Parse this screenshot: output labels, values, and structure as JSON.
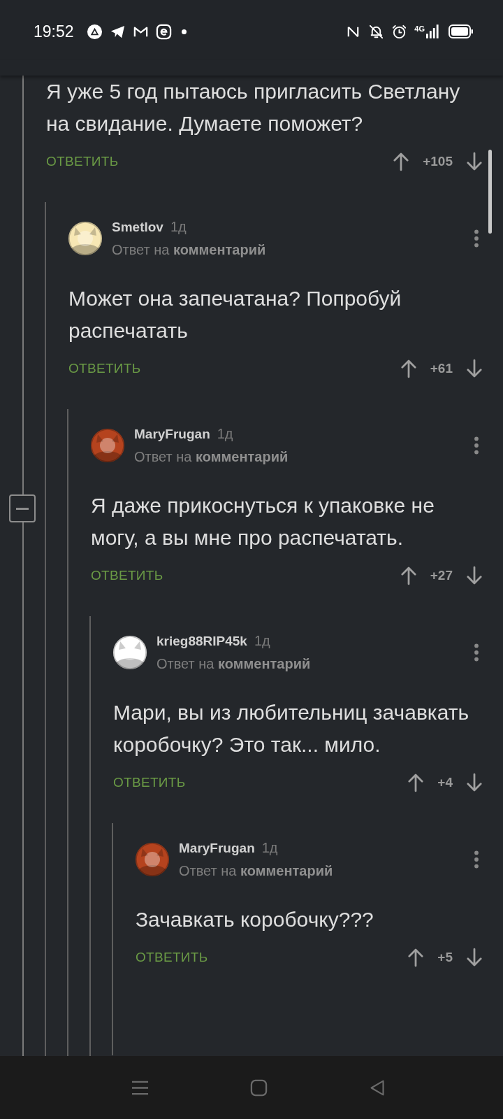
{
  "status_bar": {
    "time": "19:52",
    "network": "4G"
  },
  "thread": [
    {
      "text": "Я уже 5 год пытаюсь пригласить Светлану на свидание. Думаете поможет?",
      "reply_button": "ОТВЕТИТЬ",
      "score": "+105",
      "children": [
        {
          "author": "Smetlov",
          "age": "1д",
          "reply_to": "Ответ на",
          "reply_link": "комментарий",
          "text": "Может она запечатана? Попробуй распечатать",
          "reply_button": "ОТВЕТИТЬ",
          "score": "+61",
          "children": [
            {
              "author": "MaryFrugan",
              "age": "1д",
              "reply_to": "Ответ на",
              "reply_link": "комментарий",
              "text": "Я даже прикоснуться к упаковке не могу, а вы мне про распечатать.",
              "reply_button": "ОТВЕТИТЬ",
              "score": "+27",
              "children": [
                {
                  "author": "krieg88RIP45k",
                  "age": "1д",
                  "reply_to": "Ответ на",
                  "reply_link": "комментарий",
                  "text": "Мари, вы из любительниц зачавкать коробочку? Это так... мило.",
                  "reply_button": "ОТВЕТИТЬ",
                  "score": "+4",
                  "children": [
                    {
                      "author": "MaryFrugan",
                      "age": "1д",
                      "reply_to": "Ответ на",
                      "reply_link": "комментарий",
                      "text": "Зачавкать коробочку???",
                      "reply_button": "ОТВЕТИТЬ",
                      "score": "+5"
                    }
                  ]
                }
              ]
            }
          ]
        }
      ]
    }
  ]
}
